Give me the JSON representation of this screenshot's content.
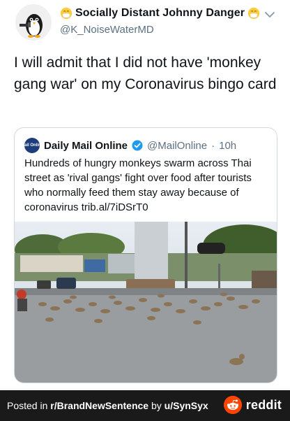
{
  "tweet": {
    "display_name": "Socially Distant Johnny Danger",
    "handle": "@K_NoiseWaterMD",
    "text": "I will admit that I did not have 'monkey gang war' on my Coronavirus bingo card"
  },
  "quoted": {
    "name": "Daily Mail Online",
    "logo_text": "Mail Online",
    "handle": "@MailOnline",
    "separator": "·",
    "time": "10h",
    "text": "Hundreds of hungry monkeys swarm across Thai street as 'rival gangs' fight over food after tourists who normally feed them stay away because of coronavirus trib.al/7iDSrT0"
  },
  "footer": {
    "prefix": "Posted in ",
    "subreddit": "r/BrandNewSentence",
    "by": " by ",
    "user": "u/SynSyx",
    "brand": "reddit"
  },
  "colors": {
    "accent": "#1d9bf0",
    "reddit_orange": "#ff4500",
    "footer_bg": "#1a1a1b"
  }
}
